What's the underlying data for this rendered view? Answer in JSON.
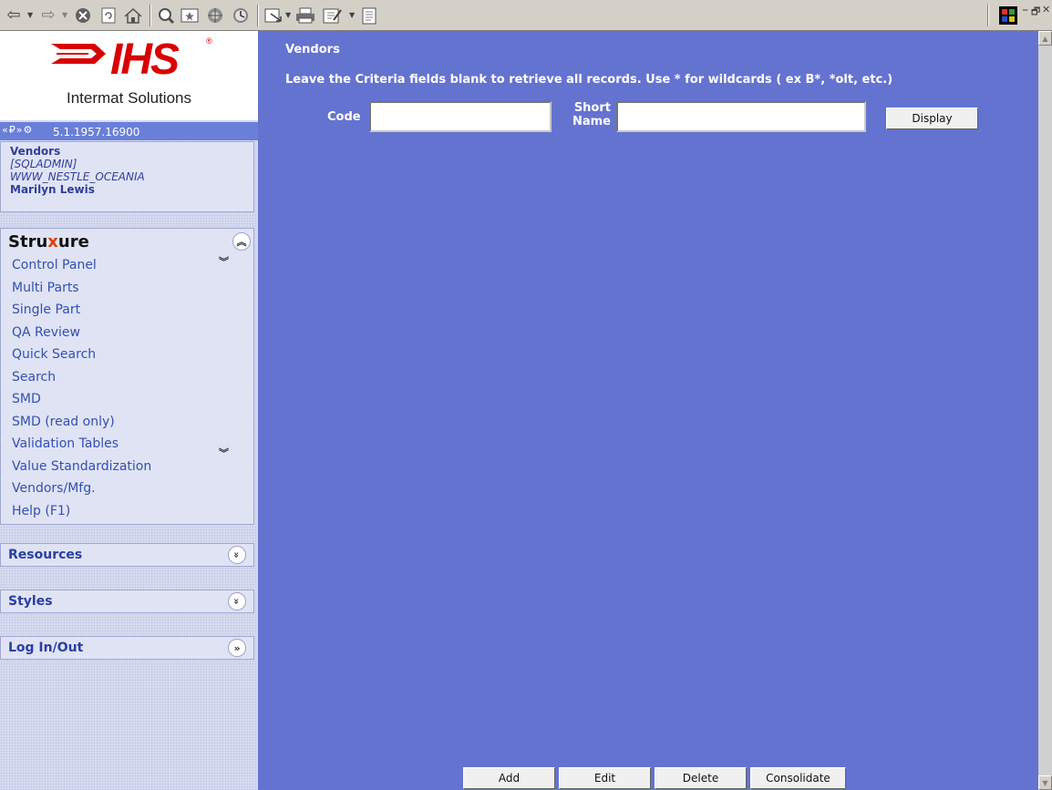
{
  "toolbar": {
    "icons": [
      "back-arrow-icon",
      "forward-arrow-icon",
      "stop-icon",
      "refresh-icon",
      "home-icon",
      "search-icon",
      "favorites-icon",
      "media-icon",
      "history-icon",
      "mail-icon",
      "print-icon",
      "edit-icon",
      "discuss-icon"
    ],
    "window_controls": [
      "–",
      "🗗",
      "✕"
    ]
  },
  "sidebar": {
    "logo_text": "IHS",
    "logo_reg": "®",
    "logo_subtitle": "Intermat Solutions",
    "version_icons": "«₽»⚙",
    "version": "5.1.1957.16900",
    "user": {
      "page": "Vendors",
      "role": "[SQLADMIN]",
      "database": "WWW_NESTLE_OCEANIA",
      "name": "Marilyn Lewis"
    },
    "struxure": {
      "title_a": "Stru",
      "title_x": "x",
      "title_b": "ure",
      "items": [
        "Control Panel",
        "Multi Parts",
        "Single Part",
        "QA Review",
        "Quick Search",
        "Search",
        "SMD",
        "SMD (read only)",
        "Validation Tables",
        "Value Standardization",
        "Vendors/Mfg.",
        "Help (F1)"
      ]
    },
    "sections": [
      {
        "label": "Resources",
        "toggle": "»"
      },
      {
        "label": "Styles",
        "toggle": "»"
      },
      {
        "label": "Log In/Out",
        "toggle": "»"
      }
    ]
  },
  "main": {
    "title": "Vendors",
    "instructions": "Leave the Criteria fields blank to retrieve all records. Use * for wildcards ( ex B*, *olt, etc.)",
    "code_label": "Code",
    "code_value": "",
    "short_name_label_1": "Short",
    "short_name_label_2": "Name",
    "short_name_value": "",
    "display_button": "Display",
    "footer_buttons": {
      "add": "Add",
      "edit": "Edit",
      "delete": "Delete",
      "consolidate": "Consolidate"
    }
  },
  "colors": {
    "main_bg": "#6473cf",
    "sidebar_bg": "#d7dcf0",
    "logo_red": "#d90000",
    "version_bar": "#6a7fd8"
  }
}
